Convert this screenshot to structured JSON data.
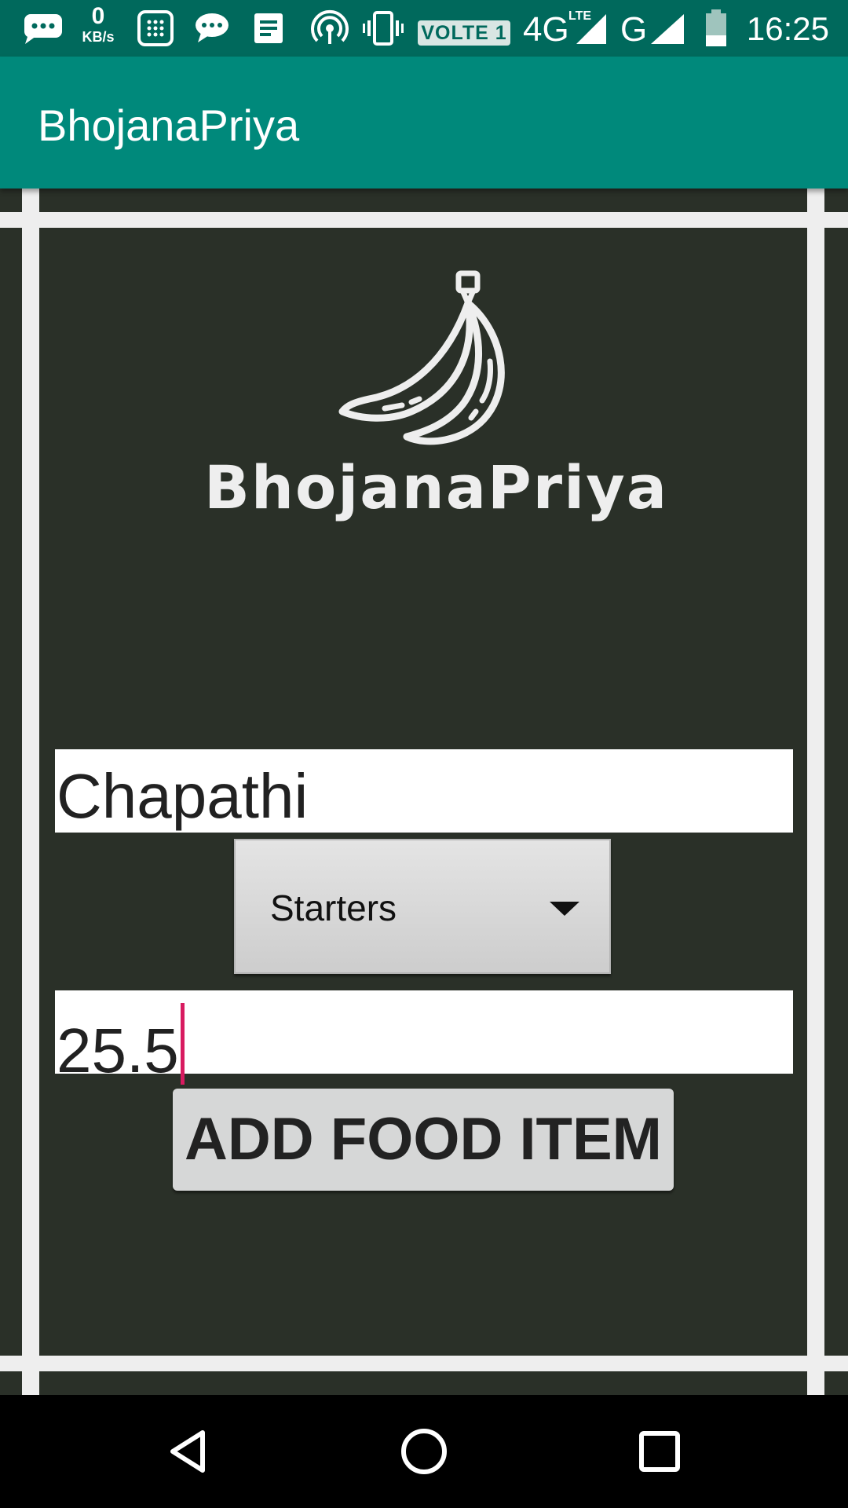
{
  "status_bar": {
    "speed_value": "0",
    "speed_unit": "KB/s",
    "volte": "VOLTE 1",
    "network_4g": "4G",
    "network_lte": "LTE",
    "network_g": "G",
    "time": "16:25",
    "icons": [
      "chat-bubble-icon",
      "calculator-icon",
      "message-icon",
      "document-icon",
      "hotspot-icon",
      "vibrate-icon",
      "signal-4g-icon",
      "signal-g-icon",
      "battery-icon"
    ]
  },
  "app_bar": {
    "title": "BhojanaPriya"
  },
  "logo": {
    "text": "BhojanaPriya",
    "icon": "banana-icon"
  },
  "form": {
    "food_name_value": "Chapathi",
    "category_selected": "Starters",
    "price_value": "25.5",
    "add_button_label": "ADD FOOD ITEM"
  },
  "nav_bar": {
    "icons": [
      "back-icon",
      "home-icon",
      "recents-icon"
    ]
  },
  "colors": {
    "status_bar": "#00695c",
    "app_bar": "#00897b",
    "background": "#2a3028",
    "frame": "#eeeeee",
    "cursor": "#d81b60"
  }
}
